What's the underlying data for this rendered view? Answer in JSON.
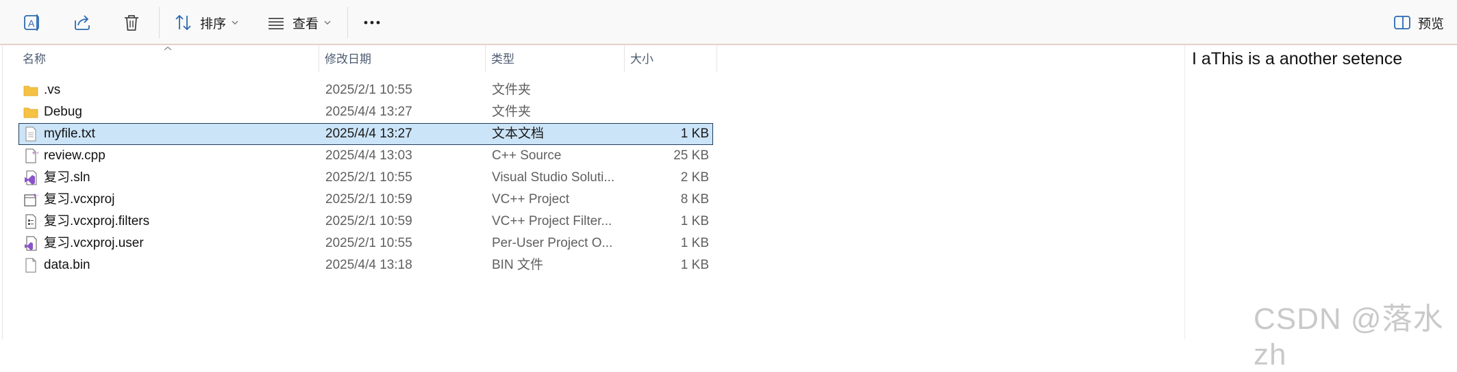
{
  "toolbar": {
    "sort_label": "排序",
    "view_label": "查看",
    "preview_label": "预览"
  },
  "columns": {
    "name": "名称",
    "date": "修改日期",
    "type": "类型",
    "size": "大小"
  },
  "files": [
    {
      "name": ".vs",
      "date": "2025/2/1 10:55",
      "type": "文件夹",
      "size": "",
      "icon": "folder-icon"
    },
    {
      "name": "Debug",
      "date": "2025/4/4 13:27",
      "type": "文件夹",
      "size": "",
      "icon": "folder-icon"
    },
    {
      "name": "myfile.txt",
      "date": "2025/4/4 13:27",
      "type": "文本文档",
      "size": "1 KB",
      "icon": "text-file-icon",
      "selected": true
    },
    {
      "name": "review.cpp",
      "date": "2025/4/4 13:03",
      "type": "C++ Source",
      "size": "25 KB",
      "icon": "cpp-file-icon"
    },
    {
      "name": "复习.sln",
      "date": "2025/2/1 10:55",
      "type": "Visual Studio Soluti...",
      "size": "2 KB",
      "icon": "solution-file-icon"
    },
    {
      "name": "复习.vcxproj",
      "date": "2025/2/1 10:59",
      "type": "VC++ Project",
      "size": "8 KB",
      "icon": "project-file-icon"
    },
    {
      "name": "复习.vcxproj.filters",
      "date": "2025/2/1 10:59",
      "type": "VC++ Project Filter...",
      "size": "1 KB",
      "icon": "filters-file-icon"
    },
    {
      "name": "复习.vcxproj.user",
      "date": "2025/2/1 10:55",
      "type": "Per-User Project O...",
      "size": "1 KB",
      "icon": "user-file-icon"
    },
    {
      "name": "data.bin",
      "date": "2025/4/4 13:18",
      "type": "BIN 文件",
      "size": "1 KB",
      "icon": "blank-file-icon"
    }
  ],
  "preview": {
    "text": "I aThis is a another setence"
  },
  "watermark": "CSDN @落水 zh",
  "colors": {
    "selection_bg": "#cce4f7",
    "selection_border": "#1d3b57",
    "accent_line": "#e7cfc7",
    "folder_yellow": "#f6c244",
    "icon_blue": "#2a6ab0"
  }
}
